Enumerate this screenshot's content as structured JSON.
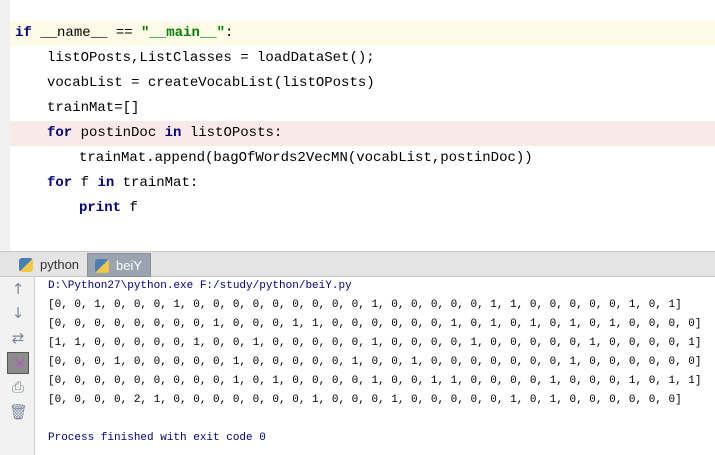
{
  "editor": {
    "lines": [
      {
        "kw": "if",
        "rest_a": " __name__ == ",
        "str": "\"__main__\"",
        "rest_b": ":"
      },
      {
        "text": "listOPosts,ListClasses = loadDataSet();"
      },
      {
        "text": "vocabList = createVocabList(listOPosts)"
      },
      {
        "text": "trainMat=[]"
      },
      {
        "kw": "for",
        "rest_a": " postinDoc ",
        "kw2": "in",
        "rest_b": " listOPosts:"
      },
      {
        "text": "trainMat.append(bagOfWords2VecMN(vocabList,postinDoc))"
      },
      {
        "kw": "for",
        "rest_a": " f ",
        "kw2": "in",
        "rest_b": " trainMat:"
      },
      {
        "kw": "print",
        "rest_a": " f"
      }
    ]
  },
  "run_tabs": [
    {
      "label": "python"
    },
    {
      "label": "beiY"
    }
  ],
  "toolbar": [
    "up-arrow-icon",
    "down-arrow-icon",
    "soft-wrap-icon",
    "scroll-to-end-icon",
    "print-icon",
    "trash-icon"
  ],
  "console": {
    "command": "D:\\Python27\\python.exe F:/study/python/beiY.py",
    "output": [
      "[0, 0, 1, 0, 0, 0, 1, 0, 0, 0, 0, 0, 0, 0, 0, 0, 1, 0, 0, 0, 0, 0, 1, 1, 0, 0, 0, 0, 0, 1, 0, 1]",
      "[0, 0, 0, 0, 0, 0, 0, 0, 1, 0, 0, 0, 1, 1, 0, 0, 0, 0, 0, 0, 1, 0, 1, 0, 1, 0, 1, 0, 1, 0, 0, 0, 0]",
      "[1, 1, 0, 0, 0, 0, 0, 1, 0, 0, 1, 0, 0, 0, 0, 0, 1, 0, 0, 0, 0, 1, 0, 0, 0, 0, 0, 1, 0, 0, 0, 0, 1]",
      "[0, 0, 0, 1, 0, 0, 0, 0, 0, 1, 0, 0, 0, 0, 0, 1, 0, 0, 1, 0, 0, 0, 0, 0, 0, 0, 1, 0, 0, 0, 0, 0, 0]",
      "[0, 0, 0, 0, 0, 0, 0, 0, 0, 1, 0, 1, 0, 0, 0, 0, 1, 0, 0, 1, 1, 0, 0, 0, 0, 1, 0, 0, 0, 1, 0, 1, 1]",
      "[0, 0, 0, 0, 2, 1, 0, 0, 0, 0, 0, 0, 0, 1, 0, 0, 0, 1, 0, 0, 0, 0, 0, 1, 0, 1, 0, 0, 0, 0, 0, 0]"
    ],
    "exit_message": "Process finished with exit code 0"
  }
}
